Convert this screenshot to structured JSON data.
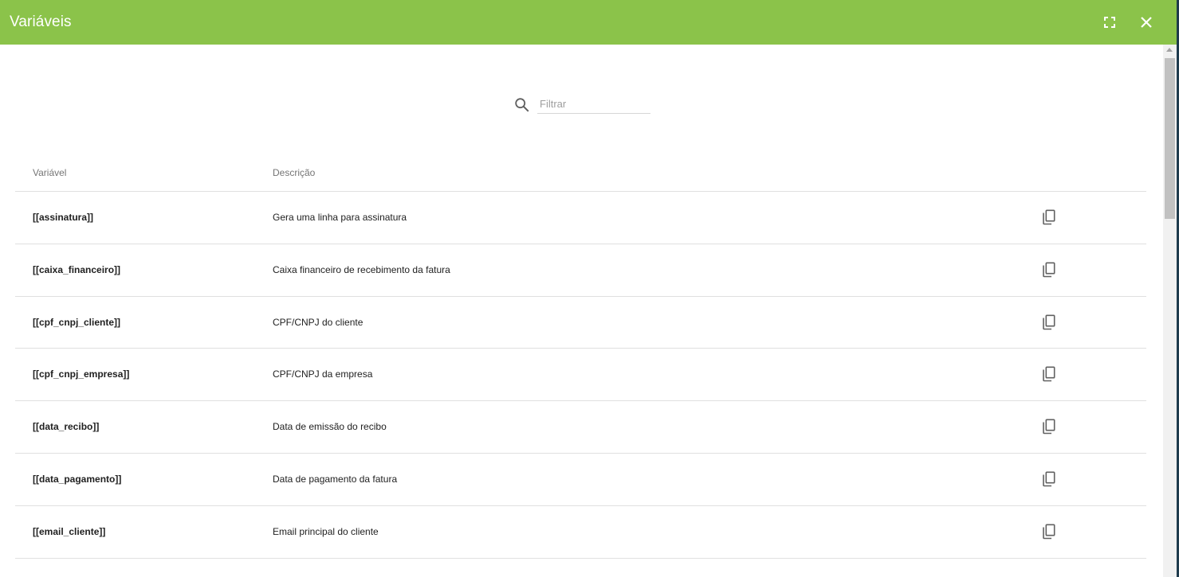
{
  "dialog": {
    "title": "Variáveis",
    "header_color": "#8bc34a"
  },
  "filter": {
    "placeholder": "Filtrar",
    "value": ""
  },
  "table": {
    "headers": {
      "variable": "Variável",
      "description": "Descrição"
    },
    "rows": [
      {
        "variable": "[[assinatura]]",
        "description": "Gera uma linha para assinatura"
      },
      {
        "variable": "[[caixa_financeiro]]",
        "description": "Caixa financeiro de recebimento da fatura"
      },
      {
        "variable": "[[cpf_cnpj_cliente]]",
        "description": "CPF/CNPJ do cliente"
      },
      {
        "variable": "[[cpf_cnpj_empresa]]",
        "description": "CPF/CNPJ da empresa"
      },
      {
        "variable": "[[data_recibo]]",
        "description": "Data de emissão do recibo"
      },
      {
        "variable": "[[data_pagamento]]",
        "description": "Data de pagamento da fatura"
      },
      {
        "variable": "[[email_cliente]]",
        "description": "Email principal do cliente"
      }
    ]
  },
  "icons": {
    "fullscreen": "fullscreen-icon",
    "close": "close-icon",
    "search": "search-icon",
    "copy": "copy-icon"
  }
}
